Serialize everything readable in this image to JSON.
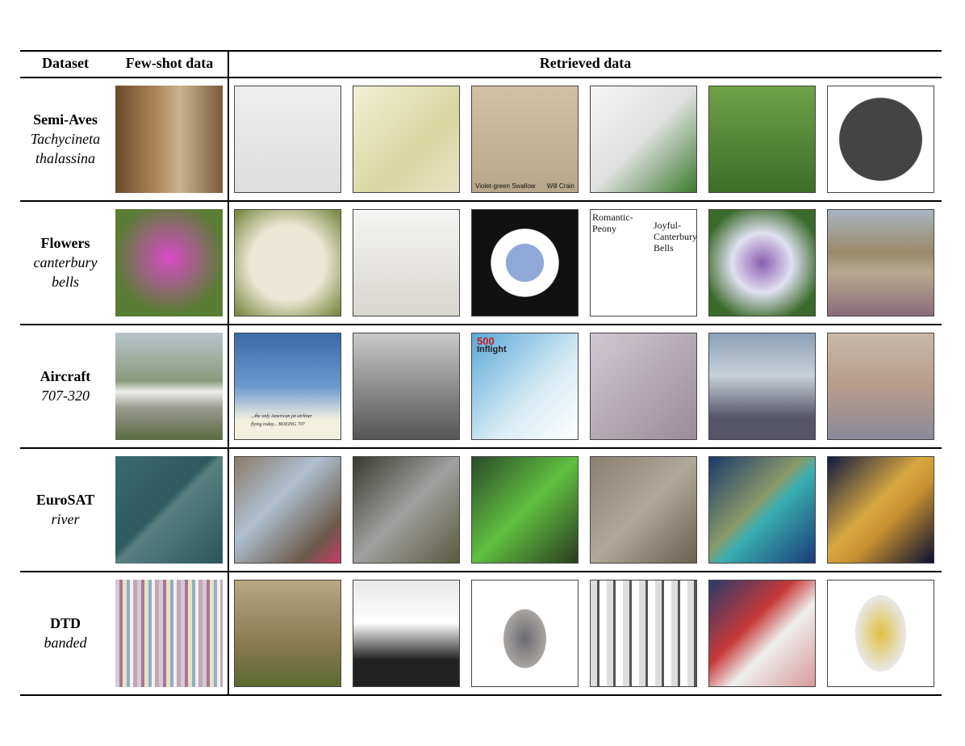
{
  "header": {
    "dataset": "Dataset",
    "few_shot": "Few-shot data",
    "retrieved": "Retrieved data"
  },
  "rows": [
    {
      "dataset": "Semi-Aves",
      "species": [
        "Tachycineta",
        "thalassina"
      ],
      "captions": {
        "2": [
          "Violet-green Swallow",
          "Will Crain"
        ]
      }
    },
    {
      "dataset": "Flowers",
      "species": [
        "canterbury",
        "bells"
      ],
      "captions": {
        "3": [
          "Romantic-",
          "Peony",
          "Joyful-",
          "Canterbury",
          "Bells"
        ]
      }
    },
    {
      "dataset": "Aircraft",
      "species": [
        "707-320"
      ],
      "captions": {
        "0": [
          "...the only American jet airliner",
          "flying today... BOEING 707"
        ],
        "2": [
          "500",
          "Inflight"
        ]
      }
    },
    {
      "dataset": "EuroSAT",
      "species": [
        "river"
      ],
      "captions": {}
    },
    {
      "dataset": "DTD",
      "species": [
        "banded"
      ],
      "captions": {}
    }
  ]
}
